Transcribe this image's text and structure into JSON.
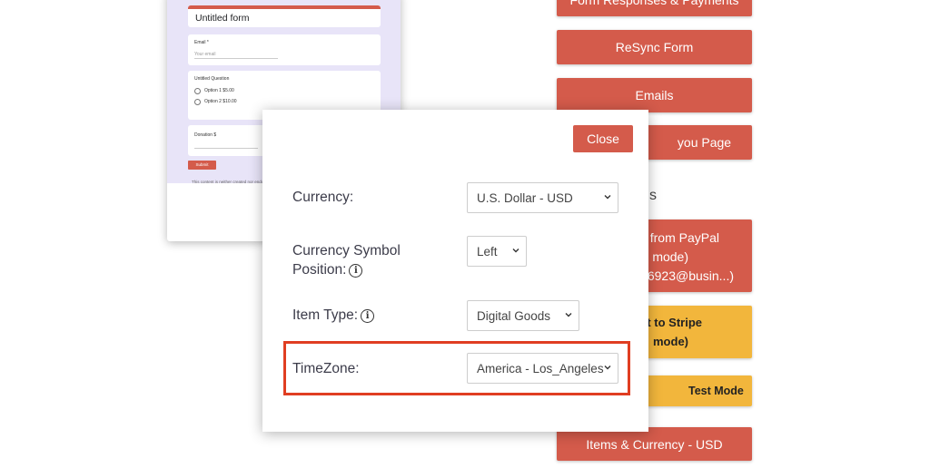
{
  "form_preview": {
    "title": "Untitled form",
    "email_label": "Email *",
    "email_placeholder": "Your email",
    "question_label": "Untitled Question",
    "options": [
      "Option 1 $5.00",
      "Option 2 $10.00"
    ],
    "donation_label": "Donation $",
    "submit_label": "Submit",
    "footnote": "This content is neither created nor endorsed"
  },
  "sidebar": {
    "buttons": {
      "responses": "Form Responses & Payments",
      "resync": "ReSync Form",
      "emails": "Emails",
      "thankyou": "you Page"
    },
    "heading_fragment": "s",
    "paypal_lines": [
      "t from PayPal",
      "mode)",
      "36923@busin...)"
    ],
    "stripe_lines": [
      "t to Stripe",
      "mode)"
    ],
    "test_mode": "Test Mode",
    "items_currency": "Items & Currency - USD"
  },
  "modal": {
    "close_label": "Close",
    "currency_label": "Currency:",
    "currency_value": "U.S. Dollar - USD",
    "symbol_label_line1": "Currency Symbol",
    "symbol_label_line2": "Position:",
    "symbol_value": "Left",
    "item_type_label": "Item Type:",
    "item_type_value": "Digital Goods",
    "timezone_label": "TimeZone:",
    "timezone_value": "America - Los_Angeles"
  },
  "colors": {
    "accent_red": "#d45b4b",
    "test_yellow": "#f2b63c",
    "highlight": "#e03e22"
  },
  "icons": {
    "info": "info-icon",
    "chevron": "chevron-down-icon"
  }
}
